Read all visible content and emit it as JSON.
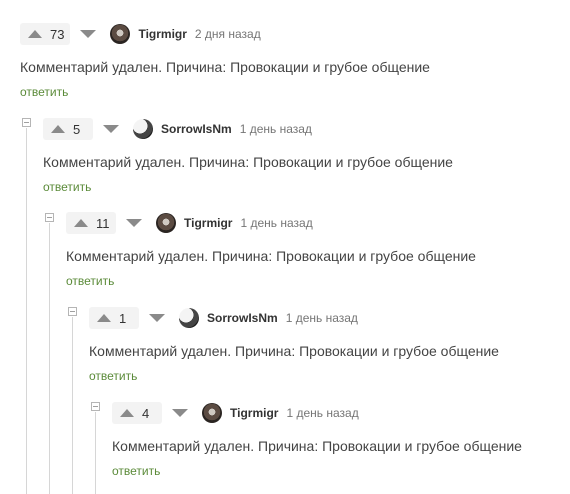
{
  "comments": [
    {
      "votes": "73",
      "author": "Tigrmigr",
      "time": "2 дня назад",
      "avatar": "tigrmigr-avatar",
      "text": "Комментарий удален. Причина: Провокации и грубое общение",
      "reply": "ответить"
    },
    {
      "votes": "5",
      "author": "SorrowIsNm",
      "time": "1 день назад",
      "avatar": "sorrowisnm-avatar",
      "text": "Комментарий удален. Причина: Провокации и грубое общение",
      "reply": "ответить"
    },
    {
      "votes": "11",
      "author": "Tigrmigr",
      "time": "1 день назад",
      "avatar": "tigrmigr-avatar",
      "text": "Комментарий удален. Причина: Провокации и грубое общение",
      "reply": "ответить"
    },
    {
      "votes": "1",
      "author": "SorrowIsNm",
      "time": "1 день назад",
      "avatar": "sorrowisnm-avatar",
      "text": "Комментарий удален. Причина: Провокации и грубое общение",
      "reply": "ответить"
    },
    {
      "votes": "4",
      "author": "Tigrmigr",
      "time": "1 день назад",
      "avatar": "tigrmigr-avatar",
      "text": "Комментарий удален. Причина: Провокации и грубое общение",
      "reply": "ответить"
    }
  ],
  "colors": {
    "reply_link": "#5a8a38",
    "vote_bg": "#f3f3f3",
    "thread_line": "#d6d6d6"
  }
}
